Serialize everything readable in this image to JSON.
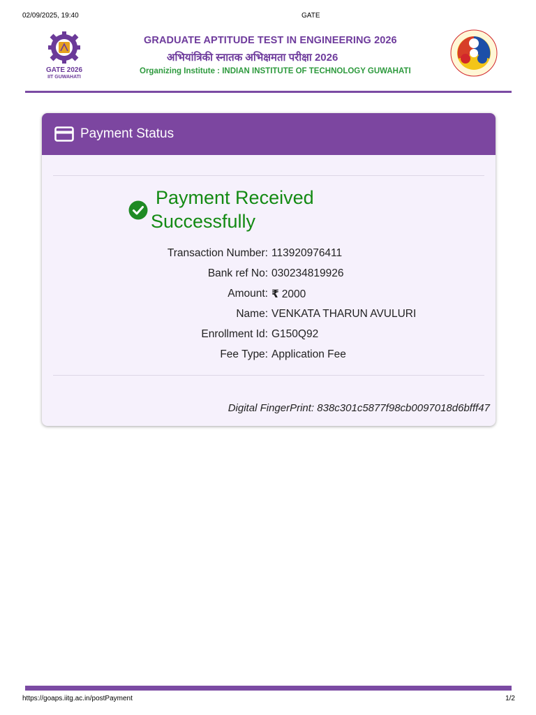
{
  "print_header": {
    "datetime": "02/09/2025, 19:40",
    "title": "GATE"
  },
  "header": {
    "left_logo_text_1": "GATE 2026",
    "left_logo_text_2": "IIT GUWAHATI",
    "title": "GRADUATE APTITUDE TEST IN ENGINEERING 2026",
    "title_hindi": "अभियांत्रिकी स्नातक अभिक्षमता परीक्षा 2026",
    "organizing": "Organizing Institute : INDIAN INSTITUTE OF TECHNOLOGY GUWAHATI",
    "brand_color": "#7b4aa3",
    "org_color": "#2e9a3e"
  },
  "card": {
    "header_icon": "credit-card-icon",
    "title": "Payment Status",
    "status_icon": "check-circle-icon",
    "status_line1": "Payment Received",
    "status_line2": "Successfully",
    "status_color": "#138a13",
    "details": [
      {
        "label": "Transaction Number:",
        "value": "113920976411"
      },
      {
        "label": "Bank ref No:",
        "value": "030234819926"
      },
      {
        "label": "Amount:",
        "currency": "₹",
        "value": "2000"
      },
      {
        "label": "Name:",
        "value": "VENKATA THARUN AVULURI"
      },
      {
        "label": "Enrollment Id:",
        "value": "G150Q92"
      },
      {
        "label": "Fee Type:",
        "value": "Application Fee"
      }
    ],
    "fingerprint": "Digital FingerPrint: 838c301c5877f98cb0097018d6bfff47"
  },
  "print_footer": {
    "url": "https://goaps.iitg.ac.in/postPayment",
    "page": "1/2"
  }
}
